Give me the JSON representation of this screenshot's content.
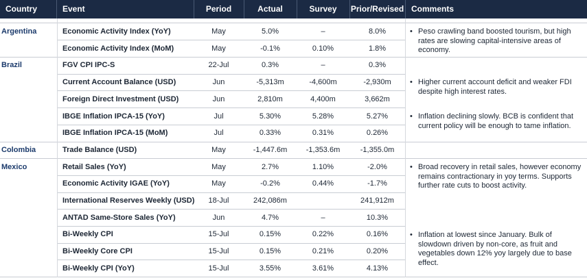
{
  "headers": [
    "Country",
    "Event",
    "Period",
    "Actual",
    "Survey",
    "Prior/Revised",
    "Comments"
  ],
  "rows": [
    {
      "country": "Argentina",
      "event": "Economic Activity Index (YoY)",
      "period": "May",
      "actual": "5.0%",
      "survey": "–",
      "prior": "8.0%"
    },
    {
      "country": "",
      "event": "Economic Activity Index (MoM)",
      "period": "May",
      "actual": "-0.1%",
      "survey": "0.10%",
      "prior": "1.8%"
    },
    {
      "country": "Brazil",
      "event": "FGV CPI IPC-S",
      "period": "22-Jul",
      "actual": "0.3%",
      "survey": "–",
      "prior": "0.3%"
    },
    {
      "country": "",
      "event": "Current Account Balance (USD)",
      "period": "Jun",
      "actual": "-5,313m",
      "survey": "-4,600m",
      "prior": "-2,930m"
    },
    {
      "country": "",
      "event": "Foreign Direct Investment (USD)",
      "period": "Jun",
      "actual": "2,810m",
      "survey": "4,400m",
      "prior": "3,662m"
    },
    {
      "country": "",
      "event": "IBGE Inflation IPCA-15 (YoY)",
      "period": "Jul",
      "actual": "5.30%",
      "survey": "5.28%",
      "prior": "5.27%"
    },
    {
      "country": "",
      "event": "IBGE Inflation IPCA-15 (MoM)",
      "period": "Jul",
      "actual": "0.33%",
      "survey": "0.31%",
      "prior": "0.26%"
    },
    {
      "country": "Colombia",
      "event": "Trade Balance (USD)",
      "period": "May",
      "actual": "-1,447.6m",
      "survey": "-1,353.6m",
      "prior": "-1,355.0m"
    },
    {
      "country": "Mexico",
      "event": "Retail Sales (YoY)",
      "period": "May",
      "actual": "2.7%",
      "survey": "1.10%",
      "prior": "-2.0%"
    },
    {
      "country": "",
      "event": "Economic Activity IGAE (YoY)",
      "period": "May",
      "actual": "-0.2%",
      "survey": "0.44%",
      "prior": "-1.7%"
    },
    {
      "country": "",
      "event": "International Reserves Weekly (USD)",
      "period": "18-Jul",
      "actual": "242,086m",
      "survey": "",
      "prior": "241,912m"
    },
    {
      "country": "",
      "event": "ANTAD Same-Store Sales (YoY)",
      "period": "Jun",
      "actual": "4.7%",
      "survey": "–",
      "prior": "10.3%"
    },
    {
      "country": "",
      "event": "Bi-Weekly CPI",
      "period": "15-Jul",
      "actual": "0.15%",
      "survey": "0.22%",
      "prior": "0.16%"
    },
    {
      "country": "",
      "event": "Bi-Weekly Core CPI",
      "period": "15-Jul",
      "actual": "0.15%",
      "survey": "0.21%",
      "prior": "0.20%"
    },
    {
      "country": "",
      "event": "Bi-Weekly CPI (YoY)",
      "period": "15-Jul",
      "actual": "3.55%",
      "survey": "3.61%",
      "prior": "4.13%"
    }
  ],
  "comments": [
    "Peso crawling band boosted tourism, but high rates are slowing capital-intensive areas of economy.",
    "Higher current account deficit and weaker FDI despite high interest rates.",
    "Inflation declining slowly. BCB is confident that current policy will be enough to tame inflation.",
    "Broad recovery in retail sales, however economy remains contractionary in yoy terms. Supports further rate cuts to boost activity.",
    "Inflation at lowest since January. Bulk of slowdown driven by non-core, as fruit and vegetables down 12% yoy largely due to base effect."
  ],
  "bullet": "•",
  "colors": {
    "header_bg": "#1b2a44",
    "header_text": "#ffffff",
    "country_text": "#1b3a6b"
  }
}
